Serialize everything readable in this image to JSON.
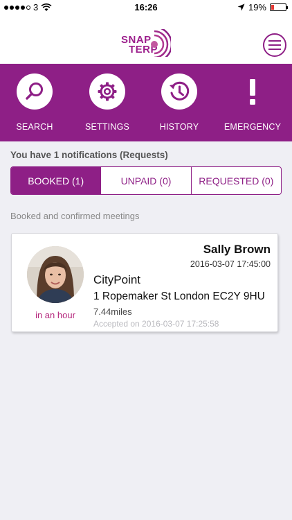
{
  "status_bar": {
    "carrier": "3",
    "time": "16:26",
    "battery": "19%",
    "battery_level": 0.19,
    "wifi_icon": "wifi-icon",
    "location_icon": "location-arrow-icon"
  },
  "header": {
    "logo_line1": "SNAP",
    "logo_line2": "TERP",
    "menu_icon": "hamburger-menu-icon",
    "brand_color": "#8e1f86"
  },
  "toolbar": {
    "items": [
      {
        "label": "SEARCH",
        "icon": "search-icon"
      },
      {
        "label": "SETTINGS",
        "icon": "gear-icon"
      },
      {
        "label": "HISTORY",
        "icon": "history-clock-icon"
      },
      {
        "label": "EMERGENCY",
        "icon": "exclamation-icon"
      }
    ]
  },
  "notifications": {
    "heading": "You have 1 notifications (Requests)"
  },
  "tabs": [
    {
      "label": "BOOKED (1)",
      "active": true
    },
    {
      "label": "UNPAID (0)",
      "active": false
    },
    {
      "label": "REQUESTED (0)",
      "active": false
    }
  ],
  "section": {
    "caption": "Booked and confirmed meetings"
  },
  "meetings": [
    {
      "name": "Sally Brown",
      "datetime": "2016-03-07 17:45:00",
      "place": "CityPoint",
      "address": "1 Ropemaker St London EC2Y 9HU",
      "distance": "7.44miles",
      "accepted": "Accepted on 2016-03-07 17:25:58",
      "eta": "in an hour"
    }
  ]
}
